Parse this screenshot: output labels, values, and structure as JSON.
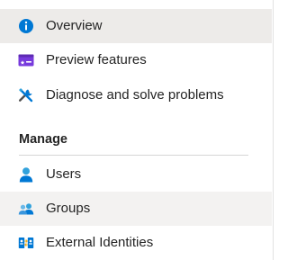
{
  "nav": {
    "items": [
      {
        "label": "Overview",
        "icon": "info-icon",
        "state": "selected"
      },
      {
        "label": "Preview features",
        "icon": "preview-features-icon"
      },
      {
        "label": "Diagnose and solve problems",
        "icon": "wrench-screwdriver-icon"
      }
    ],
    "section": {
      "title": "Manage",
      "items": [
        {
          "label": "Users",
          "icon": "user-icon"
        },
        {
          "label": "Groups",
          "icon": "group-icon",
          "state": "hover"
        },
        {
          "label": "External Identities",
          "icon": "external-identities-icon"
        }
      ]
    }
  },
  "colors": {
    "selected_bg": "#edebe9",
    "hover_bg": "#f3f2f1",
    "info_blue": "#0078d4",
    "preview_purple": "#773adc",
    "user_blue": "#0078d4"
  }
}
